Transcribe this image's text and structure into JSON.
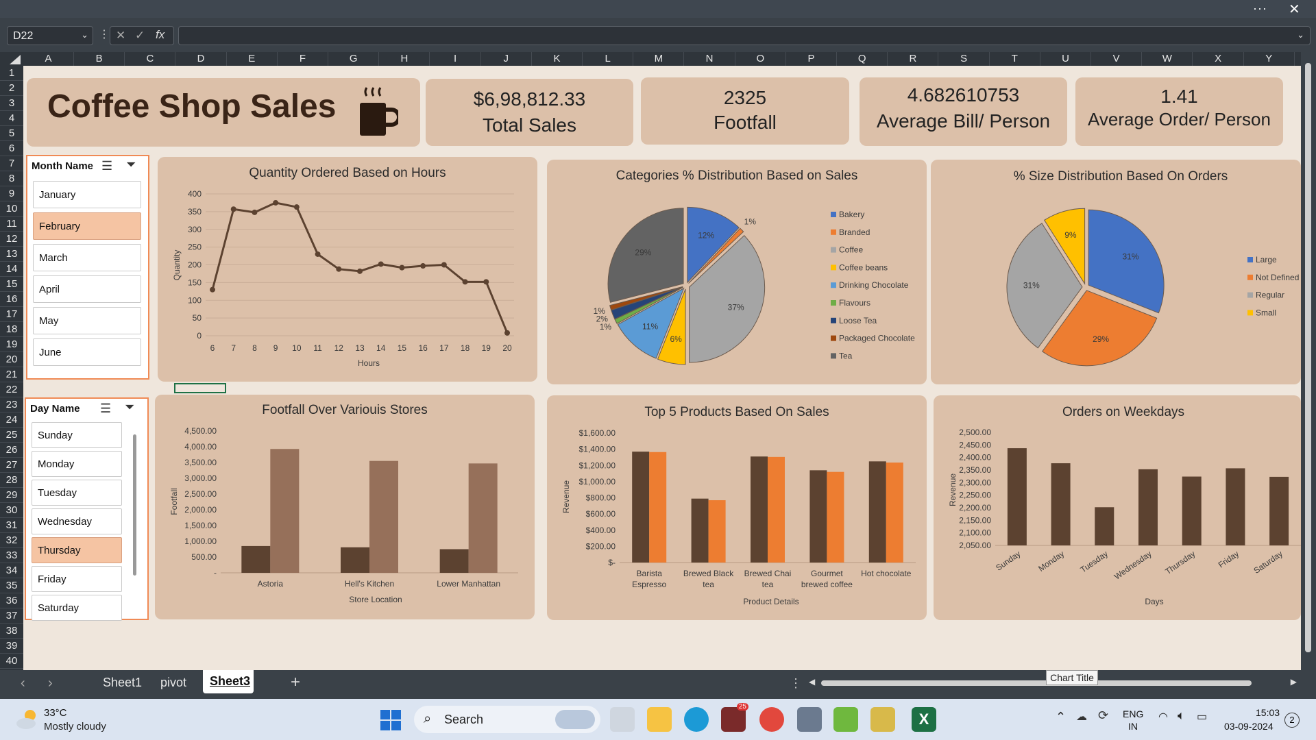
{
  "excel": {
    "name_box": "D22",
    "formula_value": "",
    "columns": [
      "A",
      "B",
      "C",
      "D",
      "E",
      "F",
      "G",
      "H",
      "I",
      "J",
      "K",
      "L",
      "M",
      "N",
      "O",
      "P",
      "Q",
      "R",
      "S",
      "T",
      "U",
      "V",
      "W",
      "X",
      "Y"
    ],
    "rows": [
      "1",
      "2",
      "3",
      "4",
      "5",
      "6",
      "7",
      "8",
      "9",
      "10",
      "11",
      "12",
      "13",
      "14",
      "15",
      "16",
      "17",
      "18",
      "19",
      "20",
      "21",
      "22",
      "23",
      "24",
      "25",
      "26",
      "27",
      "28",
      "29",
      "30",
      "31",
      "32",
      "33",
      "34",
      "35",
      "36",
      "37",
      "38",
      "39",
      "40"
    ],
    "sheet_tabs": [
      "Sheet1",
      "pivot",
      "Sheet3"
    ],
    "active_sheet": "Sheet3",
    "tooltip": "Chart Title"
  },
  "dashboard": {
    "title": "Coffee Shop Sales",
    "kpis": [
      {
        "value": "$6,98,812.33",
        "label": "Total Sales"
      },
      {
        "value": "2325",
        "label": "Footfall"
      },
      {
        "value": "4.682610753",
        "label": "Average Bill/ Person"
      },
      {
        "value": "1.41",
        "label": "Average Order/ Person"
      }
    ],
    "month_slicer": {
      "title": "Month Name",
      "items": [
        "January",
        "February",
        "March",
        "April",
        "May",
        "June"
      ],
      "selected": "February"
    },
    "day_slicer": {
      "title": "Day Name",
      "items": [
        "Sunday",
        "Monday",
        "Tuesday",
        "Wednesday",
        "Thursday",
        "Friday",
        "Saturday"
      ],
      "selected": "Thursday"
    }
  },
  "colors": {
    "dark_brown": "#5c4230",
    "light_brown": "#96705a",
    "orange": "#ed7d31",
    "blue": "#4472c4",
    "gray": "#a5a5a5",
    "yellow": "#ffc000",
    "light_blue": "#5b9bd5",
    "green": "#70ad47",
    "navy": "#264478",
    "rust": "#9e480e",
    "charcoal": "#636363"
  },
  "chart_data": [
    {
      "type": "line",
      "title": "Quantity Ordered Based on Hours",
      "xlabel": "Hours",
      "ylabel": "Quantity",
      "x": [
        6,
        7,
        8,
        9,
        10,
        11,
        12,
        13,
        14,
        15,
        16,
        17,
        18,
        19,
        20
      ],
      "values": [
        130,
        357,
        348,
        375,
        363,
        230,
        188,
        182,
        202,
        192,
        197,
        200,
        152,
        152,
        8
      ],
      "ylim": [
        0,
        400
      ],
      "yticks": [
        "0",
        "50",
        "100",
        "150",
        "200",
        "250",
        "300",
        "350",
        "400"
      ]
    },
    {
      "type": "pie",
      "title": "Categories % Distribution Based on Sales",
      "categories": [
        "Bakery",
        "Branded",
        "Coffee",
        "Coffee beans",
        "Drinking Chocolate",
        "Flavours",
        "Loose Tea",
        "Packaged Chocolate",
        "Tea"
      ],
      "values": [
        12,
        1,
        37,
        6,
        11,
        1,
        2,
        1,
        29
      ],
      "labels": [
        "12%",
        "1%",
        "37%",
        "6%",
        "11%",
        "1%",
        "2%",
        "1%",
        "29%"
      ],
      "legend": "right"
    },
    {
      "type": "pie",
      "title": "% Size Distribution Based On Orders",
      "categories": [
        "Large",
        "Not Defined",
        "Regular",
        "Small"
      ],
      "values": [
        31,
        29,
        31,
        9
      ],
      "labels": [
        "31%",
        "29%",
        "31%",
        "9%"
      ],
      "legend": "right"
    },
    {
      "type": "bar",
      "title": "Footfall Over Variouis Stores",
      "xlabel": "Store Location",
      "ylabel": "Footfall",
      "categories": [
        "Astoria",
        "Hell's Kitchen",
        "Lower Manhattan"
      ],
      "series": [
        {
          "values": [
            850,
            810,
            750
          ]
        },
        {
          "values": [
            3930,
            3550,
            3470
          ]
        }
      ],
      "ylim": [
        0,
        4500
      ],
      "yticks": [
        "-",
        "500.00",
        "1,000.00",
        "1,500.00",
        "2,000.00",
        "2,500.00",
        "3,000.00",
        "3,500.00",
        "4,000.00",
        "4,500.00"
      ]
    },
    {
      "type": "bar",
      "title": "Top 5 Products Based On Sales",
      "xlabel": "Product Details",
      "ylabel": "Revenue",
      "categories": [
        "Barista Espresso",
        "Brewed Black tea",
        "Brewed Chai tea",
        "Gourmet brewed coffee",
        "Hot chocolate"
      ],
      "series": [
        {
          "values": [
            1370,
            790,
            1310,
            1140,
            1250
          ]
        },
        {
          "values": [
            1365,
            770,
            1305,
            1120,
            1235
          ]
        }
      ],
      "ylim": [
        0,
        1600
      ],
      "yticks": [
        "$-",
        "$200.00",
        "$400.00",
        "$600.00",
        "$800.00",
        "$1,000.00",
        "$1,200.00",
        "$1,400.00",
        "$1,600.00"
      ]
    },
    {
      "type": "bar",
      "title": "Orders on Weekdays",
      "xlabel": "Days",
      "ylabel": "Revenue",
      "categories": [
        "Sunday",
        "Monday",
        "Tuesday",
        "Wednesday",
        "Thursday",
        "Friday",
        "Saturday"
      ],
      "values": [
        2437,
        2377,
        2202,
        2353,
        2324,
        2357,
        2323
      ],
      "ylim": [
        2050,
        2500
      ],
      "yticks": [
        "2,050.00",
        "2,100.00",
        "2,150.00",
        "2,200.00",
        "2,250.00",
        "2,300.00",
        "2,350.00",
        "2,400.00",
        "2,450.00",
        "2,500.00"
      ]
    }
  ],
  "taskbar": {
    "weather_temp": "33°C",
    "weather_desc": "Mostly cloudy",
    "search": "Search",
    "lang_top": "ENG",
    "lang_bottom": "IN",
    "time": "15:03",
    "date": "03-09-2024",
    "notification_count": "2",
    "telegram_badge": "25"
  }
}
